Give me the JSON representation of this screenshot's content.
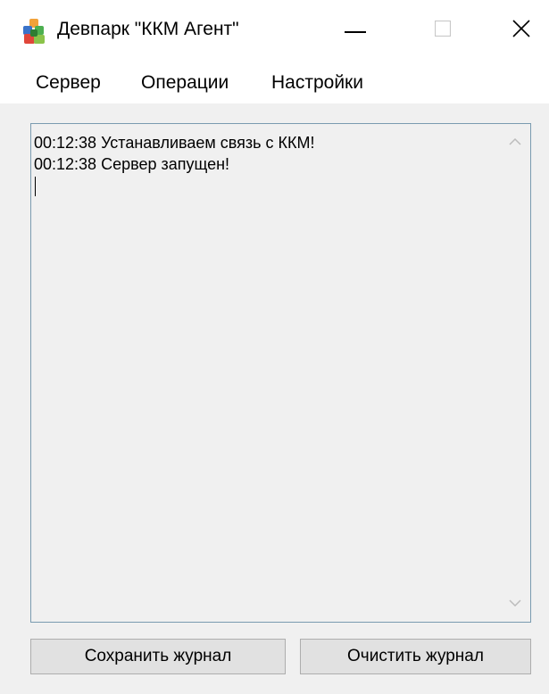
{
  "window": {
    "title": "Девпарк \"ККМ Агент\"",
    "app_icon": "devpark-app-icon",
    "controls": {
      "minimize_icon": "minimize-icon",
      "maximize_icon": "maximize-icon",
      "close_icon": "close-icon"
    }
  },
  "menu": {
    "items": [
      {
        "label": "Сервер"
      },
      {
        "label": "Операции"
      },
      {
        "label": "Настройки"
      }
    ]
  },
  "log": {
    "lines": [
      "00:12:38 Устанавливаем связь с ККМ!",
      "00:12:38 Сервер запущен!"
    ],
    "scroll_up_icon": "chevron-up-icon",
    "scroll_down_icon": "chevron-down-icon"
  },
  "buttons": {
    "save_label": "Сохранить журнал",
    "clear_label": "Очистить журнал"
  },
  "colors": {
    "titlebar_bg": "#ffffff",
    "window_bg": "#f0f0f0",
    "log_border": "#7a9bb0",
    "button_bg": "#e1e1e1",
    "button_border": "#adadad"
  }
}
